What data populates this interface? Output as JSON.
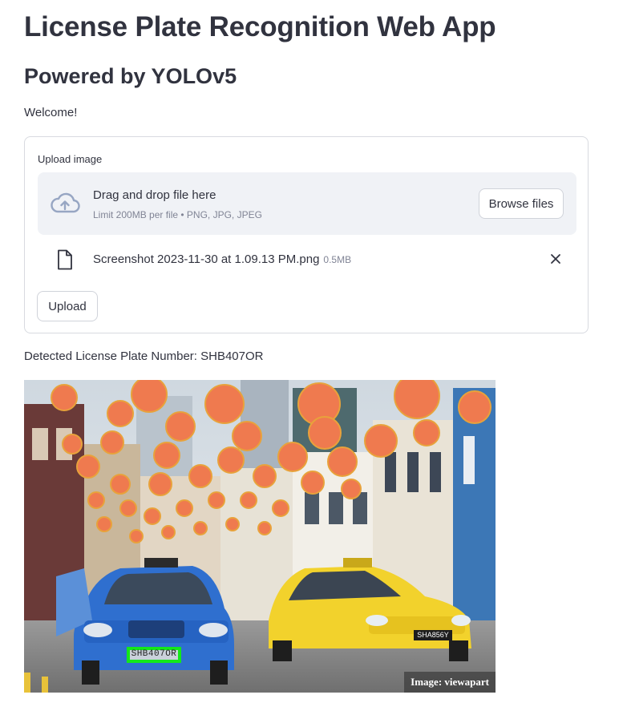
{
  "header": {
    "title": "License Plate Recognition Web App",
    "subtitle": "Powered by YOLOv5",
    "welcome": "Welcome!"
  },
  "uploader": {
    "label": "Upload image",
    "drop_text": "Drag and drop file here",
    "limit_text": "Limit 200MB per file • PNG, JPG, JPEG",
    "browse_label": "Browse files",
    "file": {
      "name": "Screenshot 2023-11-30 at 1.09.13 PM.png",
      "size": "0.5MB"
    },
    "upload_label": "Upload"
  },
  "result": {
    "text": "Detected License Plate Number: SHB407OR",
    "image_credit": "Image: viewapart",
    "detected_plate": "SHB407OR",
    "other_plate": "SHA856Y",
    "box_color": "#13e81a"
  },
  "icons": {
    "upload": "cloud-upload-icon",
    "file": "file-icon",
    "remove": "close-icon"
  }
}
